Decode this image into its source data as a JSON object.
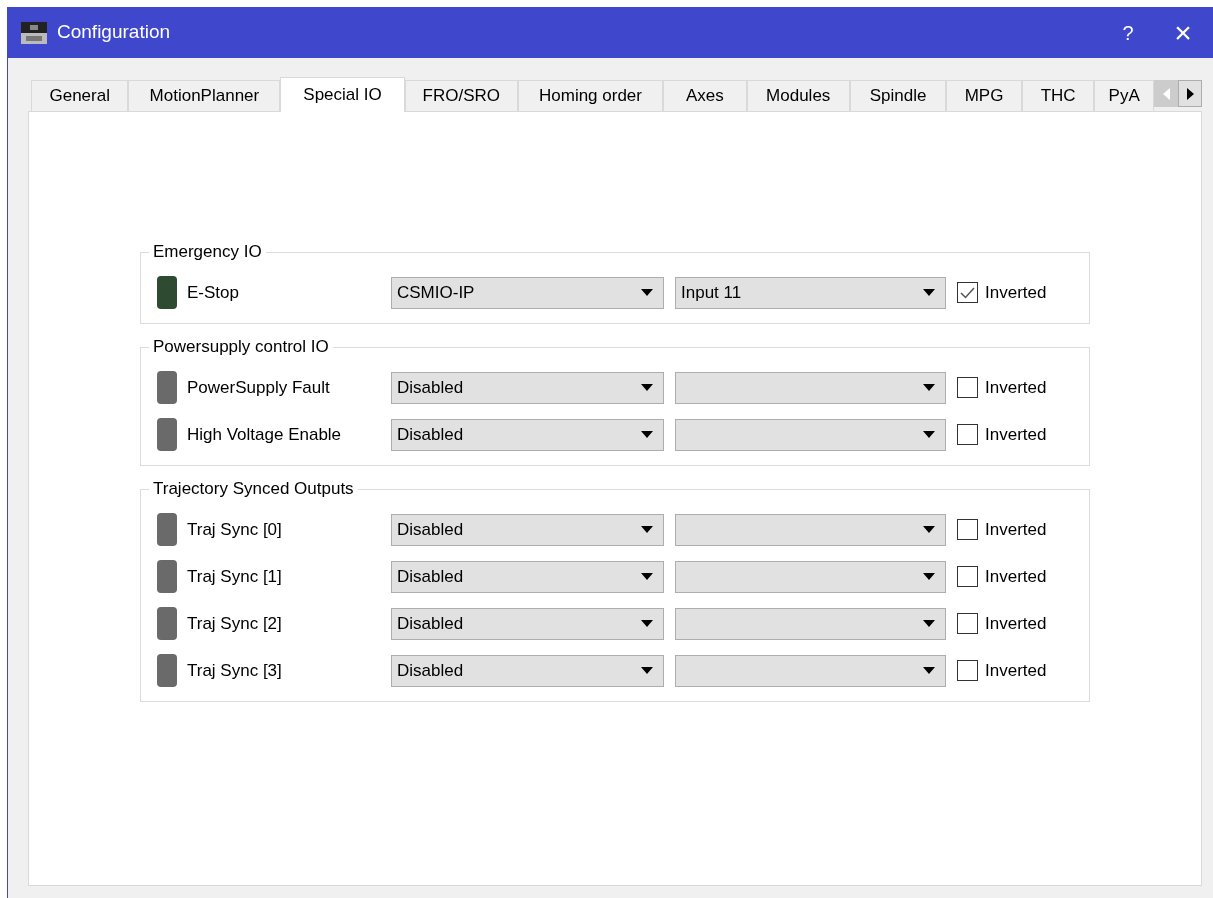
{
  "window": {
    "title": "Configuration",
    "help": "?",
    "close": "×"
  },
  "tabs": [
    {
      "label": "General",
      "selected": false
    },
    {
      "label": "MotionPlanner",
      "selected": false
    },
    {
      "label": "Special IO",
      "selected": true
    },
    {
      "label": "FRO/SRO",
      "selected": false
    },
    {
      "label": "Homing order",
      "selected": false
    },
    {
      "label": "Axes",
      "selected": false
    },
    {
      "label": "Modules",
      "selected": false
    },
    {
      "label": "Spindle",
      "selected": false
    },
    {
      "label": "MPG",
      "selected": false
    },
    {
      "label": "THC",
      "selected": false
    },
    {
      "label": "PyA",
      "selected": false
    }
  ],
  "tab_scroll": {
    "left_disabled": true,
    "right_disabled": false
  },
  "groups": [
    {
      "title": "Emergency IO",
      "rows": [
        {
          "label": "E-Stop",
          "on": true,
          "device": "CSMIO-IP",
          "input": "Input 11",
          "checkbox_label": "Inverted",
          "checked": true
        }
      ]
    },
    {
      "title": "Powersupply control IO",
      "rows": [
        {
          "label": "PowerSupply Fault",
          "on": false,
          "device": "Disabled",
          "checkbox_label": "Inverted",
          "checked": false
        },
        {
          "label": "High Voltage Enable",
          "on": false,
          "device": "Disabled",
          "checkbox_label": "Inverted",
          "checked": false
        }
      ]
    },
    {
      "title": "Trajectory Synced Outputs",
      "rows": [
        {
          "label": "Traj Sync [0]",
          "on": false,
          "device": "Disabled",
          "checkbox_label": "Inverted",
          "checked": false
        },
        {
          "label": "Traj Sync [1]",
          "on": false,
          "device": "Disabled",
          "checkbox_label": "Inverted",
          "checked": false
        },
        {
          "label": "Traj Sync [2]",
          "on": false,
          "device": "Disabled",
          "checkbox_label": "Inverted",
          "checked": false
        },
        {
          "label": "Traj Sync [3]",
          "on": false,
          "device": "Disabled",
          "checkbox_label": "Inverted",
          "checked": false
        }
      ]
    }
  ]
}
